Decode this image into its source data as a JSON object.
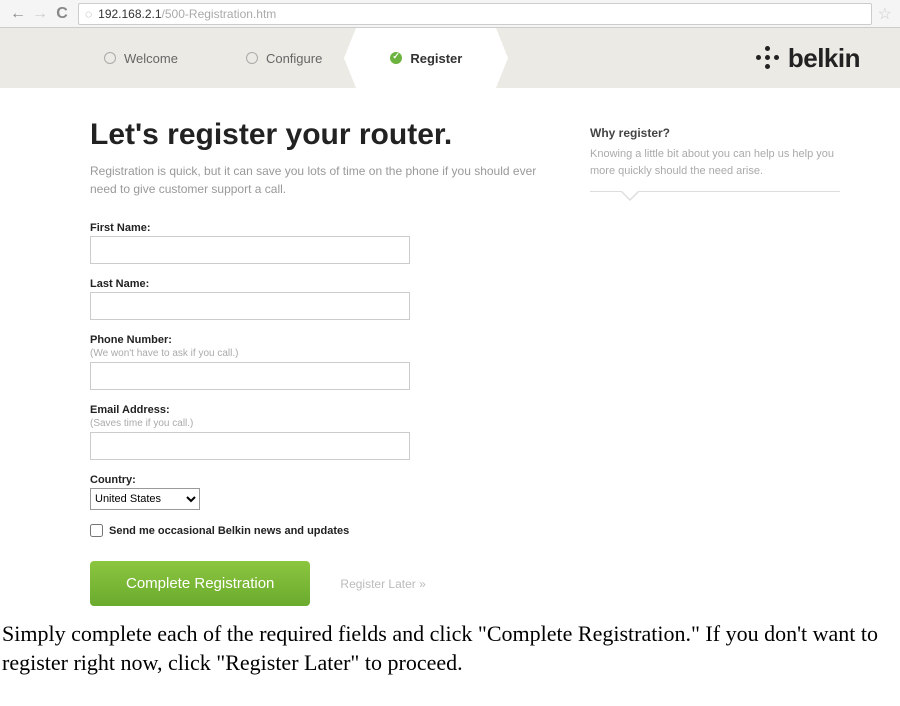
{
  "browser": {
    "url_host": "192.168.2.1",
    "url_path": "/500-Registration.htm"
  },
  "brand": {
    "name": "belkin"
  },
  "steps": [
    {
      "label": "Welcome",
      "active": false
    },
    {
      "label": "Configure",
      "active": false
    },
    {
      "label": "Register",
      "active": true
    }
  ],
  "page": {
    "title": "Let's register your router.",
    "subtitle": "Registration is quick, but it can save you lots of time on the phone if you should ever need to give customer support a call."
  },
  "form": {
    "first_name_label": "First Name:",
    "first_name_value": "",
    "last_name_label": "Last Name:",
    "last_name_value": "",
    "phone_label": "Phone Number:",
    "phone_hint": "(We won't have to ask if you call.)",
    "phone_value": "",
    "email_label": "Email Address:",
    "email_hint": "(Saves time if you call.)",
    "email_value": "",
    "country_label": "Country:",
    "country_value": "United States",
    "newsletter_label": "Send me occasional Belkin news and updates",
    "submit_label": "Complete Registration",
    "skip_label": "Register Later »"
  },
  "sidebar": {
    "heading": "Why register?",
    "body": "Knowing a little bit about you can help us help you more quickly should the need arise."
  },
  "caption": "Simply complete each of the required fields and click \"Complete Registration.\" If you don't want to register right now, click \"Register Later\" to proceed."
}
